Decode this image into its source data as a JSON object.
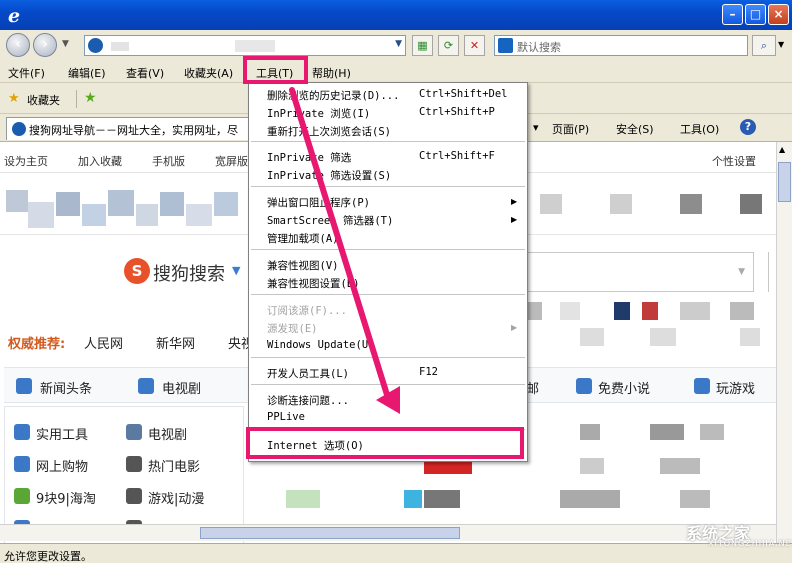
{
  "address": {
    "search_placeholder": "默认搜索",
    "search_go_label": "⌕"
  },
  "menubar": {
    "items": [
      {
        "label": "文件(F)"
      },
      {
        "label": "编辑(E)"
      },
      {
        "label": "查看(V)"
      },
      {
        "label": "收藏夹(A)"
      },
      {
        "label": "工具(T)"
      },
      {
        "label": "帮助(H)"
      }
    ]
  },
  "favbar": {
    "favorites_label": "收藏夹"
  },
  "tab": {
    "title": "搜狗网址导航－－网址大全，实用网址，尽"
  },
  "commandbar": {
    "page_label": "页面(P)",
    "safety_label": "安全(S)",
    "tools_label": "工具(O)",
    "help_label": "?"
  },
  "webpage": {
    "top_links": [
      "设为主页",
      "加入收藏",
      "手机版",
      "宽屏版"
    ],
    "personal_settings": "个性设置",
    "sogou_logo": "搜狗搜索",
    "recommend_label": "权威推荐:",
    "recommend_links": [
      "人民网",
      "新华网",
      "央视"
    ],
    "nav_links": [
      "新闻头条",
      "电视剧",
      "邮",
      "免费小说",
      "玩游戏"
    ],
    "side_items": [
      {
        "label": "实用工具",
        "label2": "电视剧"
      },
      {
        "label": "网上购物",
        "label2": "热门电影"
      },
      {
        "label": "9块9|海淘",
        "label2": "游戏|动漫"
      }
    ]
  },
  "tools_menu": {
    "groups": [
      [
        {
          "label": "删除浏览的历史记录(D)...",
          "shortcut": "Ctrl+Shift+Del"
        },
        {
          "label": "InPrivate 浏览(I)",
          "shortcut": "Ctrl+Shift+P"
        },
        {
          "label": "重新打开上次浏览会话(S)",
          "shortcut": ""
        }
      ],
      [
        {
          "label": "InPrivate 筛选",
          "shortcut": "Ctrl+Shift+F"
        },
        {
          "label": "InPrivate 筛选设置(S)",
          "shortcut": ""
        }
      ],
      [
        {
          "label": "弹出窗口阻止程序(P)",
          "shortcut": ""
        },
        {
          "label": "SmartScreen 筛选器(T)",
          "shortcut": ""
        },
        {
          "label": "管理加载项(A)",
          "shortcut": ""
        }
      ],
      [
        {
          "label": "兼容性视图(V)",
          "shortcut": ""
        },
        {
          "label": "兼容性视图设置(B)",
          "shortcut": ""
        }
      ],
      [
        {
          "label": "订阅该源(F)...",
          "shortcut": ""
        },
        {
          "label": "源发现(E)",
          "shortcut": ""
        },
        {
          "label": "Windows Update(U)",
          "shortcut": ""
        }
      ],
      [
        {
          "label": "开发人员工具(L)",
          "shortcut": "F12"
        }
      ],
      [
        {
          "label": "诊断连接问题...",
          "shortcut": ""
        },
        {
          "label": "PPLive",
          "shortcut": ""
        }
      ],
      [
        {
          "label": "Internet 选项(O)",
          "shortcut": ""
        }
      ]
    ]
  },
  "status": {
    "text": "允许您更改设置。"
  },
  "watermark": {
    "text": "系统之家",
    "sub": "XITONGZHIJIA.NET"
  },
  "colors": {
    "highlight": "#e8176f",
    "titlebar": "#0549c9"
  }
}
